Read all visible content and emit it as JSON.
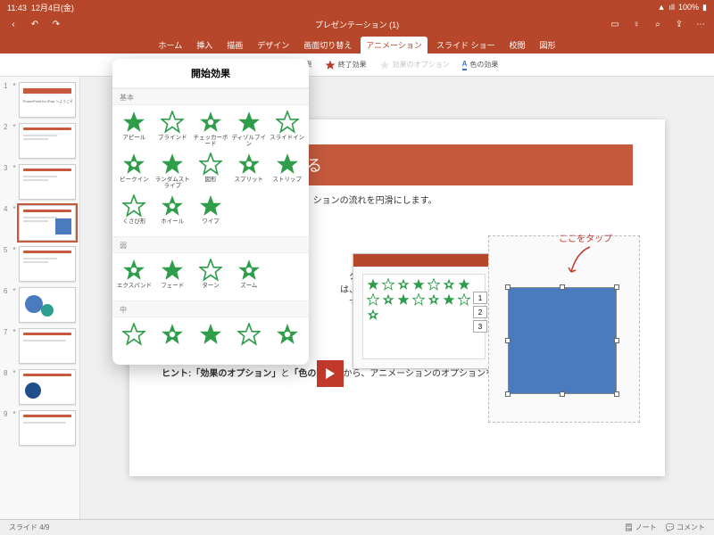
{
  "status": {
    "time": "11:43",
    "date": "12月4日(金)",
    "battery": "100%"
  },
  "doc_title": "プレゼンテーション (1)",
  "ribbon_tabs": [
    "ホーム",
    "挿入",
    "描画",
    "デザイン",
    "画面切り替え",
    "アニメーション",
    "スライド ショー",
    "校閲",
    "図形"
  ],
  "active_tab_index": 5,
  "sub_items": [
    {
      "label": "開始効果",
      "color": "#2e9e4b"
    },
    {
      "label": "強調効果",
      "color": "#e0b82e"
    },
    {
      "label": "終了効果",
      "color": "#c0392b"
    },
    {
      "label": "効果のオプション",
      "color": "#bbbbbb",
      "disabled": true
    },
    {
      "label": "色の効果",
      "color": "#3b73c9",
      "underline": true
    }
  ],
  "popover": {
    "title": "開始効果",
    "sections": [
      {
        "heading": "基本",
        "items": [
          "アピール",
          "ブラインド",
          "チェッカーボード",
          "ディゾルブイン",
          "スライドイン",
          "ピークイン",
          "ランダムストライプ",
          "図形",
          "スプリット",
          "ストリップ",
          "くさび形",
          "ホイール",
          "ワイプ"
        ]
      },
      {
        "heading": "弱",
        "items": [
          "エクスパンド",
          "フェード",
          "ターン",
          "ズーム"
        ]
      },
      {
        "heading": "中",
        "items": [
          "",
          "",
          "",
          "",
          ""
        ]
      }
    ]
  },
  "slide": {
    "title_fragment_visible": "ションを設定する",
    "body1": "ションの流れを円滑にします。",
    "body_extra_1": "タ",
    "body_extra_2": "は、",
    "body_extra_3": "で",
    "body_tail": "イドショーを表示します。",
    "hint_prefix": "ヒント:",
    "hint_bold1": "「効果のオプション」",
    "hint_mid": "と",
    "hint_bold2": "「色の効果」",
    "hint_tail": "から、アニメーションのオプションを選択できます。",
    "tap_label": "ここをタップ"
  },
  "tags": [
    "1",
    "2",
    "3"
  ],
  "thumbs": [
    1,
    2,
    3,
    4,
    5,
    6,
    7,
    8,
    9
  ],
  "active_thumb": 4,
  "bottom": {
    "counter": "スライド 4/9",
    "notes": "ノート",
    "comments": "コメント"
  }
}
